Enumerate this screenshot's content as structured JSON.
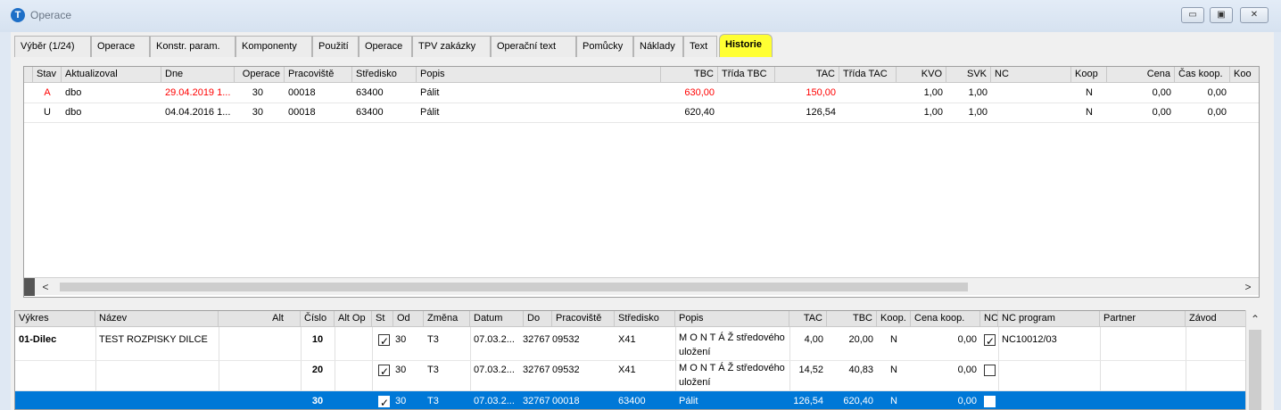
{
  "window": {
    "title": "Operace",
    "icon_glyph": "T",
    "buttons": {
      "minimize": "▭",
      "maximize": "▣",
      "close": "✕"
    }
  },
  "tabs": [
    "Výběr (1/24)",
    "Operace",
    "Konstr. param.",
    "Komponenty",
    "Použití",
    "Operace",
    "TPV zakázky",
    "Operační text",
    "Pomůcky",
    "Náklady",
    "Text",
    "Historie"
  ],
  "active_tab": "Historie",
  "history": {
    "columns": [
      "Stav",
      "Aktualizoval",
      "Dne",
      "Operace",
      "Pracoviště",
      "Středisko",
      "Popis",
      "TBC",
      "Třída TBC",
      "TAC",
      "Třída TAC",
      "KVO",
      "SVK",
      "NC",
      "Koop",
      "Cena",
      "Čas koop.",
      "Koo"
    ],
    "rows": [
      {
        "stav": "A",
        "aktualizoval": "dbo",
        "dne": "29.04.2019 1...",
        "operace": "30",
        "pracoviste": "00018",
        "stredisko": "63400",
        "popis": "Pálit",
        "tbc": "630,00",
        "tac": "150,00",
        "kvo": "1,00",
        "svk": "1,00",
        "koop": "N",
        "cena": "0,00",
        "cas_koop": "0,00"
      },
      {
        "stav": "U",
        "aktualizoval": "dbo",
        "dne": "04.04.2016 1...",
        "operace": "30",
        "pracoviste": "00018",
        "stredisko": "63400",
        "popis": "Pálit",
        "tbc": "620,40",
        "tac": "126,54",
        "kvo": "1,00",
        "svk": "1,00",
        "koop": "N",
        "cena": "0,00",
        "cas_koop": "0,00"
      }
    ],
    "changed_color": "#ff0000"
  },
  "operations": {
    "columns": [
      "Výkres",
      "Název",
      "Alt",
      "Číslo",
      "Alt Op",
      "St",
      "Od",
      "Změna",
      "Datum",
      "Do",
      "Pracoviště",
      "Středisko",
      "Popis",
      "TAC",
      "TBC",
      "Koop.",
      "Cena koop.",
      "NC",
      "NC program",
      "Partner",
      "Závod"
    ],
    "rows": [
      {
        "vykres": "01-Dilec",
        "nazev": "TEST ROZPISKY DILCE",
        "cislo": "10",
        "st": true,
        "od": "30",
        "zmena": "T3",
        "datum": "07.03.2...",
        "do": "32767",
        "pracoviste": "09532",
        "stredisko": "X41",
        "popis_1": "M O N T Á Ž středového",
        "popis_2": "uložení",
        "tac": "4,00",
        "tbc": "20,00",
        "koop": "N",
        "cena_koop": "0,00",
        "nc": true,
        "nc_program": "NC10012/03",
        "selected": false
      },
      {
        "vykres": "",
        "nazev": "",
        "cislo": "20",
        "st": true,
        "od": "30",
        "zmena": "T3",
        "datum": "07.03.2...",
        "do": "32767",
        "pracoviste": "09532",
        "stredisko": "X41",
        "popis_1": "M O N T Á Ž středového",
        "popis_2": "uložení",
        "tac": "14,52",
        "tbc": "40,83",
        "koop": "N",
        "cena_koop": "0,00",
        "nc": false,
        "nc_program": "",
        "selected": false
      },
      {
        "vykres": "",
        "nazev": "",
        "cislo": "30",
        "st": true,
        "od": "30",
        "zmena": "T3",
        "datum": "07.03.2...",
        "do": "32767",
        "pracoviste": "00018",
        "stredisko": "63400",
        "popis_1": "Pálit",
        "popis_2": "",
        "tac": "126,54",
        "tbc": "620,40",
        "koop": "N",
        "cena_koop": "0,00",
        "nc": false,
        "nc_program": "",
        "selected": true
      }
    ],
    "selection_color": "#0078d7"
  },
  "scroll": {
    "left_arrow": "<",
    "right_arrow": ">",
    "up_arrow": "⌃"
  }
}
